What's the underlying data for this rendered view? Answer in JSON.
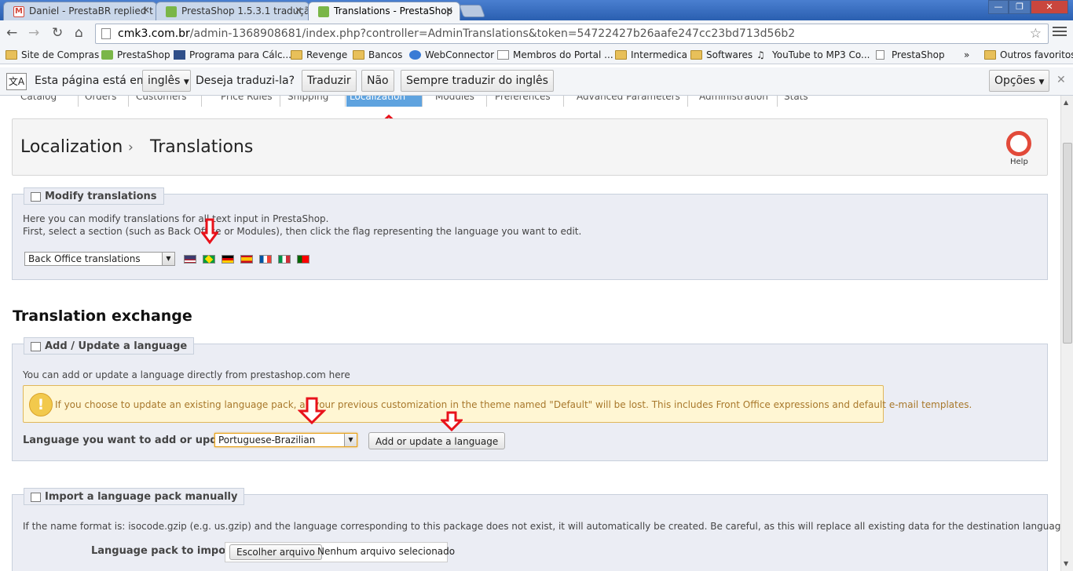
{
  "browser": {
    "tabs": [
      {
        "title": "Daniel - PrestaBR replied t",
        "favicon": "gmail-icon",
        "color": "#d44638"
      },
      {
        "title": "PrestaShop 1.5.3.1 traduçã",
        "favicon": "prestashop-icon",
        "color": "#7ab648"
      },
      {
        "title": "Translations - PrestaShop",
        "favicon": "prestashop-icon",
        "color": "#7ab648"
      }
    ],
    "url_domain": "cmk3.com.br",
    "url_path": "/admin-1368908681/index.php?controller=AdminTranslations&token=54722427b26aafe247cc23bd713d56b2",
    "bookmarks": [
      {
        "label": "Site de Compras",
        "icon": "folder"
      },
      {
        "label": "PrestaShop",
        "icon": "prestashop"
      },
      {
        "label": "Programa para Cálc...",
        "icon": "app"
      },
      {
        "label": "Revenge",
        "icon": "folder"
      },
      {
        "label": "Bancos",
        "icon": "folder"
      },
      {
        "label": "WebConnector",
        "icon": "globe"
      },
      {
        "label": "Membros do Portal ...",
        "icon": "page"
      },
      {
        "label": "Intermedica",
        "icon": "folder"
      },
      {
        "label": "Softwares",
        "icon": "folder"
      },
      {
        "label": "YouTube to MP3 Co...",
        "icon": "music"
      },
      {
        "label": "PrestaShop",
        "icon": "page"
      },
      {
        "label": "»",
        "icon": "none"
      },
      {
        "label": "Outros favoritos",
        "icon": "folder"
      }
    ],
    "translate_bar": {
      "prompt": "Esta página está em",
      "language": "inglês",
      "question": "Deseja traduzi-la?",
      "translate_btn": "Traduzir",
      "no_btn": "Não",
      "always_btn": "Sempre traduzir do inglês",
      "options_btn": "Opções"
    }
  },
  "admin": {
    "menu": [
      "Catalog",
      "Orders",
      "Customers",
      "Price Rules",
      "Shipping",
      "Localization",
      "Modules",
      "Preferences",
      "Advanced Parameters",
      "Administration",
      "Stats"
    ],
    "breadcrumb_parent": "Localization",
    "breadcrumb_sep": "›",
    "breadcrumb_current": "Translations",
    "help_label": "Help",
    "modify": {
      "legend": "Modify translations",
      "line1": "Here you can modify translations for all text input in PrestaShop.",
      "line2": "First, select a section (such as Back Office or Modules), then click the flag representing the language you want to edit.",
      "section_select": "Back Office translations",
      "flags": [
        "en",
        "br",
        "de",
        "es",
        "fr",
        "it",
        "pt"
      ]
    },
    "exchange_title": "Translation exchange",
    "add_update": {
      "legend": "Add / Update a language",
      "intro": "You can add or update a language directly from prestashop.com here",
      "warning": "If you choose to update an existing language pack, all your previous customization in the theme named \"Default\" will be lost. This includes Front Office expressions and default e-mail templates.",
      "label": "Language you want to add or update:",
      "selected": "Portuguese-Brazilian",
      "button": "Add or update a language"
    },
    "import": {
      "legend": "Import a language pack manually",
      "intro": "If the name format is: isocode.gzip (e.g. us.gzip) and the language corresponding to this package does not exist, it will automatically be created. Be careful, as this will replace all existing data for the destination language!",
      "label": "Language pack to import:",
      "file_button": "Escolher arquivo",
      "file_status": "Nenhum arquivo selecionado"
    }
  }
}
